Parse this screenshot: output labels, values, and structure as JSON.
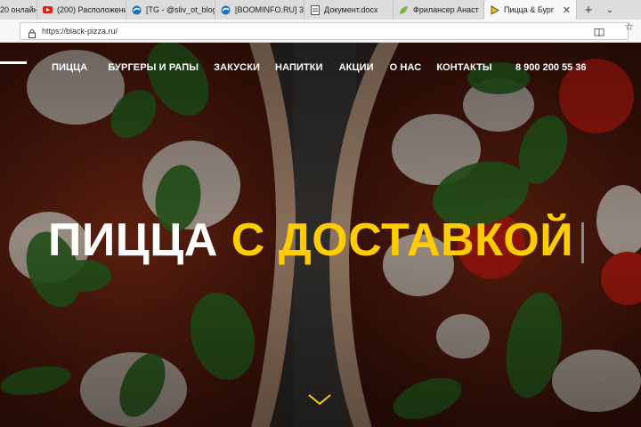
{
  "browser": {
    "tabs": [
      {
        "label": "20 онлайн",
        "icon": "blank-icon"
      },
      {
        "label": "(200) Расположени",
        "icon": "youtube-icon"
      },
      {
        "label": "[TG - @sliv_ot_blog",
        "icon": "edge-icon"
      },
      {
        "label": "[BOOMINFO.RU] 3",
        "icon": "edge-icon"
      },
      {
        "label": "Документ.docx",
        "icon": "document-icon"
      },
      {
        "label": "Фрилансер Анаст",
        "icon": "leaf-icon"
      },
      {
        "label": "Пицца & Бург",
        "icon": "play-icon",
        "active": true
      }
    ],
    "new_tab_label": "+",
    "tab_menu_label": "⌄",
    "close_label": "✕",
    "url": "https://black-pizza.ru/",
    "favorite_label": "☆"
  },
  "site": {
    "nav": [
      "ПИЦЦА",
      "БУРГЕРЫ И РАПЫ",
      "ЗАКУСКИ",
      "НАПИТКИ",
      "АКЦИИ",
      "О НАС",
      "КОНТАКТЫ"
    ],
    "phone": "8 900 200 55 36",
    "headline_white": "ПИЦЦА ",
    "headline_yellow": "С ДОСТАВКОЙ",
    "accent_color": "#ffcc00"
  }
}
